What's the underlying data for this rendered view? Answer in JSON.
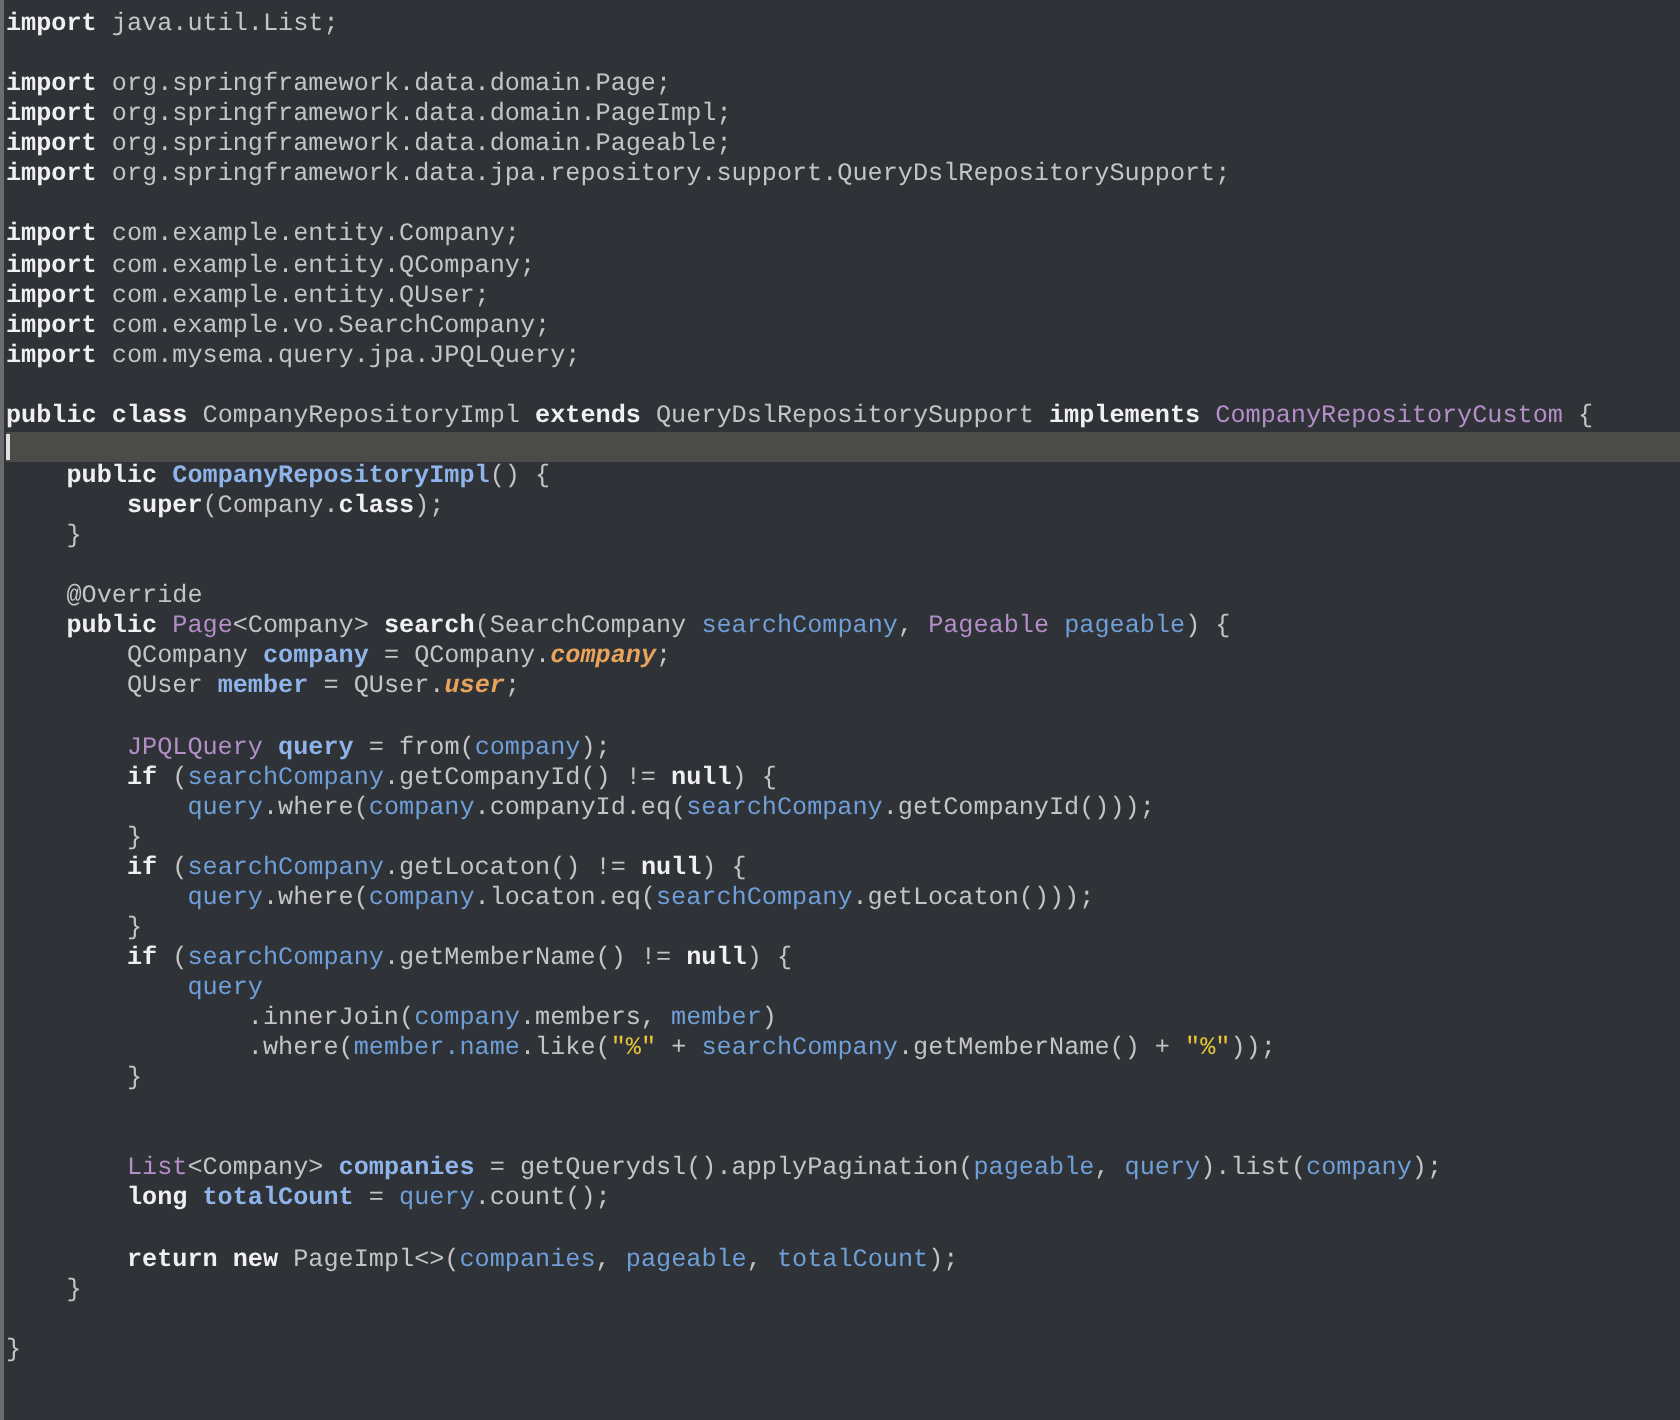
{
  "editor": {
    "lines": [
      {
        "current": false,
        "tokens": [
          {
            "kind": "kw",
            "text": "import"
          },
          {
            "kind": "plain",
            "text": " java.util.List;"
          }
        ]
      },
      {
        "current": false
      },
      {
        "current": false,
        "tokens": [
          {
            "kind": "kw",
            "text": "import"
          },
          {
            "kind": "plain",
            "text": " org.springframework.data.domain.Page;"
          }
        ]
      },
      {
        "current": false,
        "tokens": [
          {
            "kind": "kw",
            "text": "import"
          },
          {
            "kind": "plain",
            "text": " org.springframework.data.domain.PageImpl;"
          }
        ]
      },
      {
        "current": false,
        "tokens": [
          {
            "kind": "kw",
            "text": "import"
          },
          {
            "kind": "plain",
            "text": " org.springframework.data.domain.Pageable;"
          }
        ]
      },
      {
        "current": false,
        "tokens": [
          {
            "kind": "kw",
            "text": "import"
          },
          {
            "kind": "plain",
            "text": " org.springframework.data.jpa.repository.support.QueryDslRepositorySupport;"
          }
        ]
      },
      {
        "current": false
      },
      {
        "current": false,
        "tokens": [
          {
            "kind": "kw",
            "text": "import"
          },
          {
            "kind": "plain",
            "text": " com.example.entity.Company;"
          }
        ]
      },
      {
        "current": false,
        "tokens": [
          {
            "kind": "kw",
            "text": "import"
          },
          {
            "kind": "plain",
            "text": " com.example.entity.QCompany;"
          }
        ]
      },
      {
        "current": false,
        "tokens": [
          {
            "kind": "kw",
            "text": "import"
          },
          {
            "kind": "plain",
            "text": " com.example.entity.QUser;"
          }
        ]
      },
      {
        "current": false,
        "tokens": [
          {
            "kind": "kw",
            "text": "import"
          },
          {
            "kind": "plain",
            "text": " com.example.vo.SearchCompany;"
          }
        ]
      },
      {
        "current": false,
        "tokens": [
          {
            "kind": "kw",
            "text": "import"
          },
          {
            "kind": "plain",
            "text": " com.mysema.query.jpa.JPQLQuery;"
          }
        ]
      },
      {
        "current": false
      },
      {
        "current": false,
        "tokens": [
          {
            "kind": "kw",
            "text": "public class"
          },
          {
            "kind": "plain",
            "text": " CompanyRepositoryImpl "
          },
          {
            "kind": "kw",
            "text": "extends"
          },
          {
            "kind": "plain",
            "text": " QueryDslRepositorySupport "
          },
          {
            "kind": "kw",
            "text": "implements "
          },
          {
            "kind": "type",
            "text": "CompanyRepositoryCustom"
          },
          {
            "kind": "plain",
            "text": " {"
          }
        ]
      },
      {
        "current": true
      },
      {
        "current": false,
        "tokens": [
          {
            "kind": "kw",
            "text": "    public "
          },
          {
            "kind": "decl",
            "text": "CompanyRepositoryImpl"
          },
          {
            "kind": "plain",
            "text": "() {"
          }
        ]
      },
      {
        "current": false,
        "tokens": [
          {
            "kind": "kw",
            "text": "        super"
          },
          {
            "kind": "plain",
            "text": "(Company."
          },
          {
            "kind": "kw",
            "text": "class"
          },
          {
            "kind": "plain",
            "text": ");"
          }
        ]
      },
      {
        "current": false,
        "tokens": [
          {
            "kind": "plain",
            "text": "    }"
          }
        ]
      },
      {
        "current": false
      },
      {
        "current": false,
        "tokens": [
          {
            "kind": "plain",
            "text": "    @Override"
          }
        ]
      },
      {
        "current": false,
        "tokens": [
          {
            "kind": "kw",
            "text": "    public "
          },
          {
            "kind": "type",
            "text": "Page"
          },
          {
            "kind": "plain",
            "text": "<Company> "
          },
          {
            "kind": "kw",
            "text": "search"
          },
          {
            "kind": "plain",
            "text": "(SearchCompany "
          },
          {
            "kind": "var",
            "text": "searchCompany"
          },
          {
            "kind": "plain",
            "text": ", "
          },
          {
            "kind": "type",
            "text": "Pageable"
          },
          {
            "kind": "var",
            "text": " pageable"
          },
          {
            "kind": "plain",
            "text": ") {"
          }
        ]
      },
      {
        "current": false,
        "tokens": [
          {
            "kind": "plain",
            "text": "        QCompany "
          },
          {
            "kind": "decl",
            "text": "company"
          },
          {
            "kind": "plain",
            "text": " = QCompany."
          },
          {
            "kind": "static",
            "text": "company"
          },
          {
            "kind": "plain",
            "text": ";"
          }
        ]
      },
      {
        "current": false,
        "tokens": [
          {
            "kind": "plain",
            "text": "        QUser "
          },
          {
            "kind": "decl",
            "text": "member"
          },
          {
            "kind": "plain",
            "text": " = QUser."
          },
          {
            "kind": "static",
            "text": "user"
          },
          {
            "kind": "plain",
            "text": ";"
          }
        ]
      },
      {
        "current": false
      },
      {
        "current": false,
        "tokens": [
          {
            "kind": "type",
            "text": "        JPQLQuery "
          },
          {
            "kind": "decl",
            "text": "query"
          },
          {
            "kind": "plain",
            "text": " = from("
          },
          {
            "kind": "var",
            "text": "company"
          },
          {
            "kind": "plain",
            "text": ");"
          }
        ]
      },
      {
        "current": false,
        "tokens": [
          {
            "kind": "kw",
            "text": "        if"
          },
          {
            "kind": "plain",
            "text": " ("
          },
          {
            "kind": "var",
            "text": "searchCompany"
          },
          {
            "kind": "plain",
            "text": ".getCompanyId() != "
          },
          {
            "kind": "kw",
            "text": "null"
          },
          {
            "kind": "plain",
            "text": ") {"
          }
        ]
      },
      {
        "current": false,
        "tokens": [
          {
            "kind": "var",
            "text": "            query"
          },
          {
            "kind": "plain",
            "text": ".where("
          },
          {
            "kind": "var",
            "text": "company"
          },
          {
            "kind": "plain",
            "text": ".companyId.eq("
          },
          {
            "kind": "var",
            "text": "searchCompany"
          },
          {
            "kind": "plain",
            "text": ".getCompanyId()));"
          }
        ]
      },
      {
        "current": false,
        "tokens": [
          {
            "kind": "plain",
            "text": "        }"
          }
        ]
      },
      {
        "current": false,
        "tokens": [
          {
            "kind": "kw",
            "text": "        if"
          },
          {
            "kind": "plain",
            "text": " ("
          },
          {
            "kind": "var",
            "text": "searchCompany"
          },
          {
            "kind": "plain",
            "text": ".getLocaton() != "
          },
          {
            "kind": "kw",
            "text": "null"
          },
          {
            "kind": "plain",
            "text": ") {"
          }
        ]
      },
      {
        "current": false,
        "tokens": [
          {
            "kind": "var",
            "text": "            query"
          },
          {
            "kind": "plain",
            "text": ".where("
          },
          {
            "kind": "var",
            "text": "company"
          },
          {
            "kind": "plain",
            "text": ".locaton.eq("
          },
          {
            "kind": "var",
            "text": "searchCompany"
          },
          {
            "kind": "plain",
            "text": ".getLocaton()));"
          }
        ]
      },
      {
        "current": false,
        "tokens": [
          {
            "kind": "plain",
            "text": "        }"
          }
        ]
      },
      {
        "current": false,
        "tokens": [
          {
            "kind": "kw",
            "text": "        if"
          },
          {
            "kind": "plain",
            "text": " ("
          },
          {
            "kind": "var",
            "text": "searchCompany"
          },
          {
            "kind": "plain",
            "text": ".getMemberName() != "
          },
          {
            "kind": "kw",
            "text": "null"
          },
          {
            "kind": "plain",
            "text": ") {"
          }
        ]
      },
      {
        "current": false,
        "tokens": [
          {
            "kind": "var",
            "text": "            query"
          }
        ]
      },
      {
        "current": false,
        "tokens": [
          {
            "kind": "plain",
            "text": "                .innerJoin("
          },
          {
            "kind": "var",
            "text": "company"
          },
          {
            "kind": "plain",
            "text": ".members,"
          },
          {
            "kind": "var",
            "text": " member"
          },
          {
            "kind": "plain",
            "text": ")"
          }
        ]
      },
      {
        "current": false,
        "tokens": [
          {
            "kind": "plain",
            "text": "                .where("
          },
          {
            "kind": "var",
            "text": "member.name"
          },
          {
            "kind": "plain",
            "text": ".like("
          },
          {
            "kind": "str",
            "text": "\"%\""
          },
          {
            "kind": "plain",
            "text": " + "
          },
          {
            "kind": "var",
            "text": "searchCompany"
          },
          {
            "kind": "plain",
            "text": ".getMemberName() + "
          },
          {
            "kind": "str",
            "text": "\"%\""
          },
          {
            "kind": "plain",
            "text": "));"
          }
        ]
      },
      {
        "current": false,
        "tokens": [
          {
            "kind": "plain",
            "text": "        }"
          }
        ]
      },
      {
        "current": false
      },
      {
        "current": false
      },
      {
        "current": false,
        "tokens": [
          {
            "kind": "type",
            "text": "        List"
          },
          {
            "kind": "plain",
            "text": "<Company> "
          },
          {
            "kind": "decl",
            "text": "companies"
          },
          {
            "kind": "plain",
            "text": " = getQuerydsl().applyPagination("
          },
          {
            "kind": "var",
            "text": "pageable"
          },
          {
            "kind": "plain",
            "text": ","
          },
          {
            "kind": "var",
            "text": " query"
          },
          {
            "kind": "plain",
            "text": ").list("
          },
          {
            "kind": "var",
            "text": "company"
          },
          {
            "kind": "plain",
            "text": ");"
          }
        ]
      },
      {
        "current": false,
        "tokens": [
          {
            "kind": "kw",
            "text": "        long "
          },
          {
            "kind": "decl",
            "text": "totalCount"
          },
          {
            "kind": "plain",
            "text": " = "
          },
          {
            "kind": "var",
            "text": "query"
          },
          {
            "kind": "plain",
            "text": ".count();"
          }
        ]
      },
      {
        "current": false
      },
      {
        "current": false,
        "tokens": [
          {
            "kind": "kw",
            "text": "        return new"
          },
          {
            "kind": "plain",
            "text": " PageImpl<>("
          },
          {
            "kind": "var",
            "text": "companies"
          },
          {
            "kind": "plain",
            "text": ","
          },
          {
            "kind": "var",
            "text": " pageable"
          },
          {
            "kind": "plain",
            "text": ","
          },
          {
            "kind": "var",
            "text": " totalCount"
          },
          {
            "kind": "plain",
            "text": ");"
          }
        ]
      },
      {
        "current": false,
        "tokens": [
          {
            "kind": "plain",
            "text": "    }"
          }
        ]
      },
      {
        "current": false
      },
      {
        "current": false,
        "tokens": [
          {
            "kind": "plain",
            "text": "}"
          }
        ]
      }
    ]
  }
}
